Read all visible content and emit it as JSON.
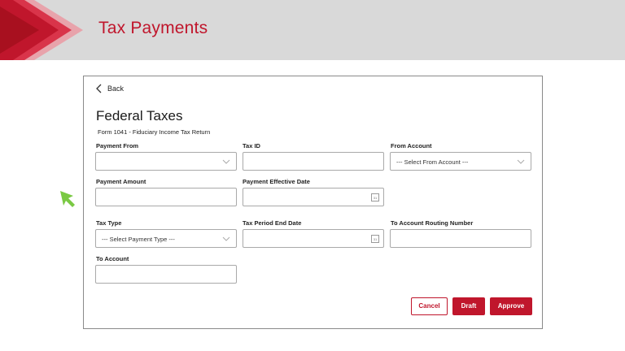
{
  "header": {
    "title": "Tax Payments"
  },
  "form": {
    "back_label": "Back",
    "title": "Federal Taxes",
    "subtitle": "Form 1041 - Fiduciary Income Tax Return",
    "fields": {
      "payment_from": {
        "label": "Payment From",
        "value": ""
      },
      "tax_id": {
        "label": "Tax ID",
        "value": ""
      },
      "from_account": {
        "label": "From Account",
        "value": "--- Select From Account ---"
      },
      "payment_amount": {
        "label": "Payment Amount",
        "value": ""
      },
      "payment_effective_date": {
        "label": "Payment Effective Date",
        "value": ""
      },
      "tax_type": {
        "label": "Tax Type",
        "value": "--- Select Payment Type ---"
      },
      "tax_period_end_date": {
        "label": "Tax Period End Date",
        "value": ""
      },
      "to_account_routing_number": {
        "label": "To Account Routing Number",
        "value": ""
      },
      "to_account": {
        "label": "To Account",
        "value": ""
      }
    },
    "calendar_icon_text": "31",
    "buttons": {
      "cancel": "Cancel",
      "draft": "Draft",
      "approve": "Approve"
    }
  },
  "colors": {
    "accent": "#c0162c",
    "header_bg": "#d9d9d9",
    "cursor": "#7ac943"
  },
  "icons": {
    "back": "chevron-left-icon",
    "dropdown": "chevron-down-icon",
    "calendar": "calendar-icon",
    "cursor": "mouse-pointer-icon"
  }
}
